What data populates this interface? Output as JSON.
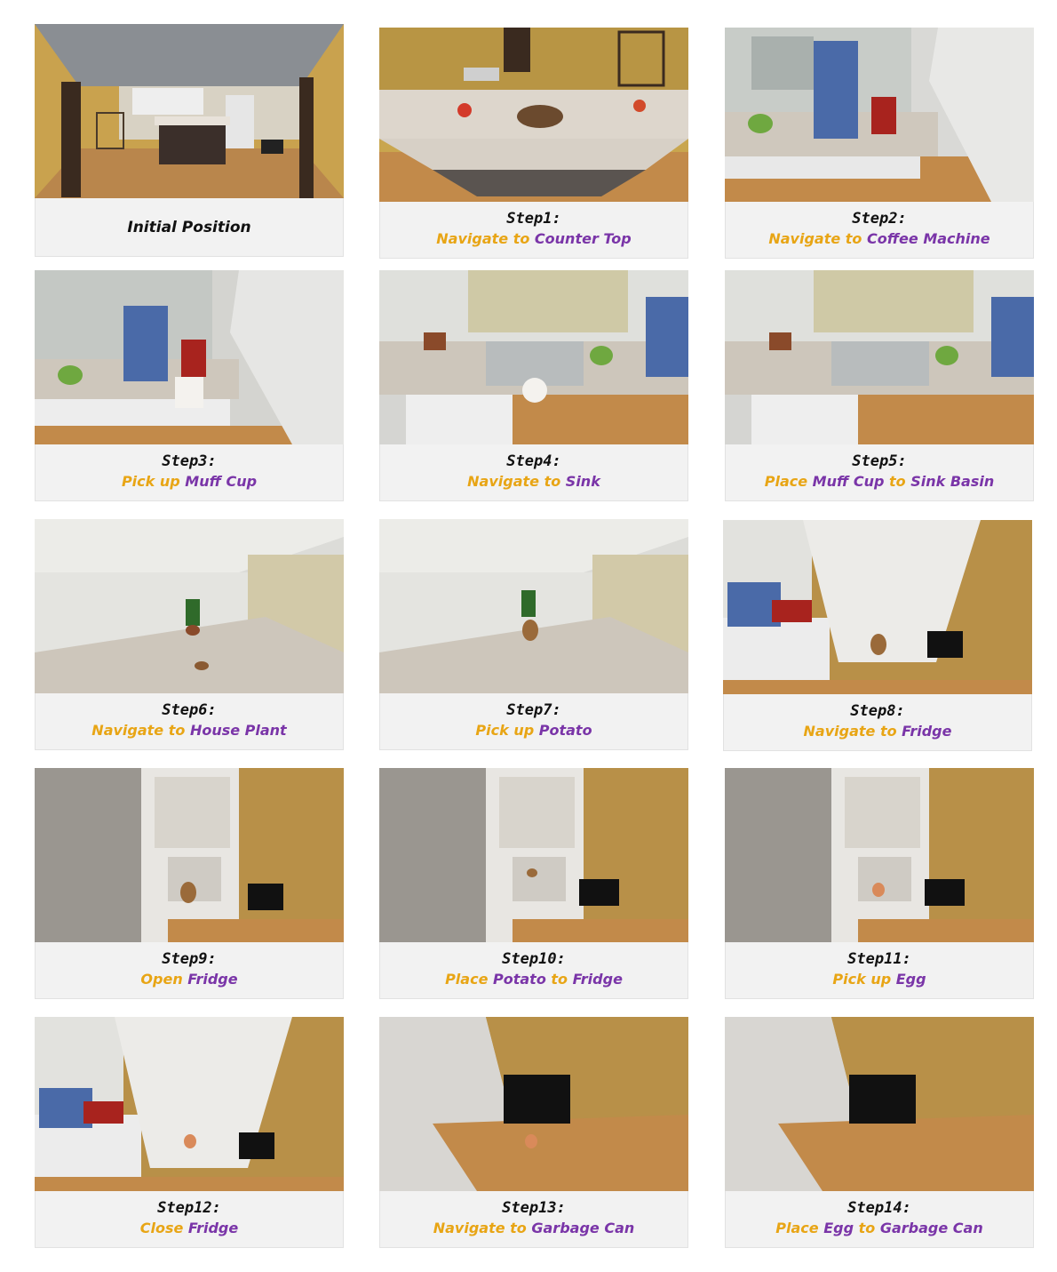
{
  "colors": {
    "action": "#e8a515",
    "object": "#7a35a8",
    "caption_bg": "#f2f2f2"
  },
  "panels": [
    {
      "caption": "Initial Position"
    },
    {
      "step": "Step1:",
      "parts": [
        {
          "t": "Navigate to",
          "k": "verb"
        },
        {
          "t": "Counter Top",
          "k": "obj"
        }
      ]
    },
    {
      "step": "Step2:",
      "parts": [
        {
          "t": "Navigate to",
          "k": "verb"
        },
        {
          "t": "Coffee Machine",
          "k": "obj"
        }
      ]
    },
    {
      "step": "Step3:",
      "parts": [
        {
          "t": "Pick up",
          "k": "verb"
        },
        {
          "t": "Muff Cup",
          "k": "obj"
        }
      ]
    },
    {
      "step": "Step4:",
      "parts": [
        {
          "t": "Navigate to",
          "k": "verb"
        },
        {
          "t": "Sink",
          "k": "obj"
        }
      ]
    },
    {
      "step": "Step5:",
      "parts": [
        {
          "t": "Place",
          "k": "verb"
        },
        {
          "t": "Muff Cup",
          "k": "obj"
        },
        {
          "t": "to",
          "k": "verb"
        },
        {
          "t": "Sink Basin",
          "k": "obj"
        }
      ]
    },
    {
      "step": "Step6:",
      "parts": [
        {
          "t": "Navigate to",
          "k": "verb"
        },
        {
          "t": "House Plant",
          "k": "obj"
        }
      ]
    },
    {
      "step": "Step7:",
      "parts": [
        {
          "t": "Pick up",
          "k": "verb"
        },
        {
          "t": "Potato",
          "k": "obj"
        }
      ]
    },
    {
      "step": "Step8:",
      "parts": [
        {
          "t": "Navigate to",
          "k": "verb"
        },
        {
          "t": "Fridge",
          "k": "obj"
        }
      ]
    },
    {
      "step": "Step9:",
      "parts": [
        {
          "t": "Open",
          "k": "verb"
        },
        {
          "t": "Fridge",
          "k": "obj"
        }
      ]
    },
    {
      "step": "Step10:",
      "parts": [
        {
          "t": "Place",
          "k": "verb"
        },
        {
          "t": "Potato",
          "k": "obj"
        },
        {
          "t": "to",
          "k": "verb"
        },
        {
          "t": "Fridge",
          "k": "obj"
        }
      ]
    },
    {
      "step": "Step11:",
      "parts": [
        {
          "t": "Pick up",
          "k": "verb"
        },
        {
          "t": "Egg",
          "k": "obj"
        }
      ]
    },
    {
      "step": "Step12:",
      "parts": [
        {
          "t": "Close",
          "k": "verb"
        },
        {
          "t": "Fridge",
          "k": "obj"
        }
      ]
    },
    {
      "step": "Step13:",
      "parts": [
        {
          "t": "Navigate to",
          "k": "verb"
        },
        {
          "t": "Garbage Can",
          "k": "obj"
        }
      ]
    },
    {
      "step": "Step14:",
      "parts": [
        {
          "t": "Place",
          "k": "verb"
        },
        {
          "t": "Egg",
          "k": "obj"
        },
        {
          "t": "to",
          "k": "verb"
        },
        {
          "t": "Garbage Can",
          "k": "obj"
        }
      ]
    }
  ]
}
